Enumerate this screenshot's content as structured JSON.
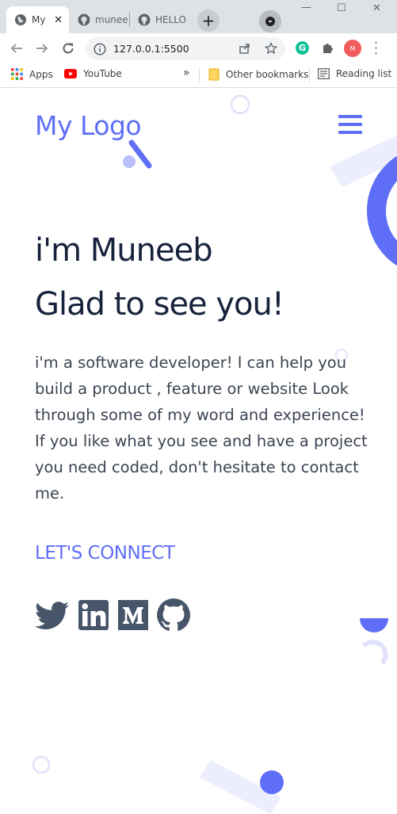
{
  "browser": {
    "tabs": [
      {
        "label": "My",
        "active": true
      },
      {
        "label": "munee",
        "active": false
      },
      {
        "label": "HELLO",
        "active": false
      }
    ],
    "url": "127.0.0.1:5500",
    "avatar_initial": "M",
    "bookmarks": {
      "apps": "Apps",
      "youtube": "YouTube",
      "overflow": "»",
      "other": "Other bookmarks",
      "reading": "Reading list"
    }
  },
  "page": {
    "logo": "My Logo",
    "title_line1": "i'm Muneeb",
    "title_line2": "Glad to see you!",
    "intro": "i'm a software developer! I can help you build a product , feature or website Look through some of my word and experience! If you like what you see and have a project you need coded, don't hesitate to contact me.",
    "connect_heading": "LET'S CONNECT",
    "social": [
      "twitter-icon",
      "linkedin-icon",
      "medium-icon",
      "github-icon"
    ]
  },
  "colors": {
    "accent": "#5f6ef7",
    "heading": "#17223b",
    "body_text": "#3b4452",
    "social_icon": "#475569"
  }
}
